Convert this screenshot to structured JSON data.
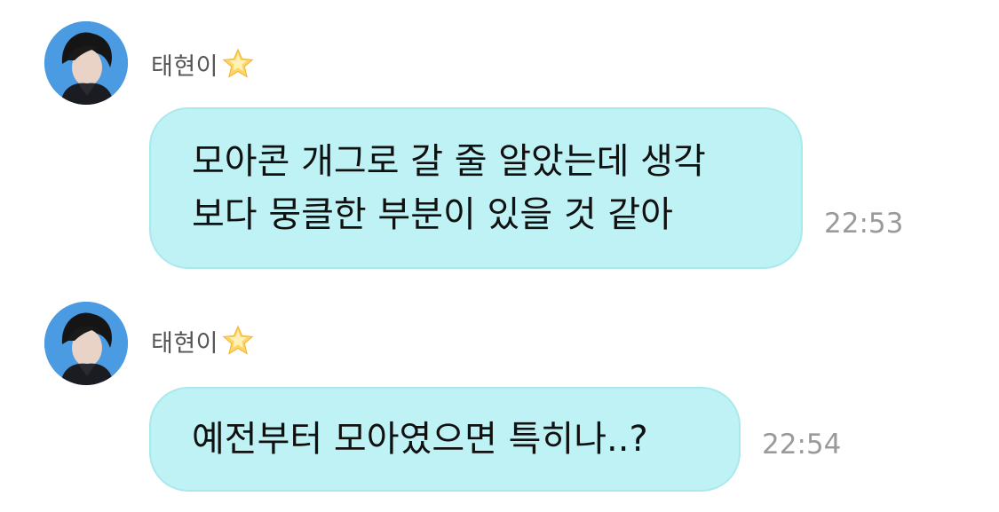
{
  "messages": [
    {
      "sender": "태현이",
      "sender_badge": "star-icon",
      "lines": [
        "모아콘 개그로 갈 줄 알았는데 생각",
        "보다 뭉클한 부분이 있을 것 같아"
      ],
      "time": "22:53"
    },
    {
      "sender": "태현이",
      "sender_badge": "star-icon",
      "lines": [
        "예전부터 모아였으면 특히나..?"
      ],
      "time": "22:54"
    }
  ],
  "colors": {
    "bubble": "#bff2f5",
    "bubble_border": "#a9e9ee",
    "timestamp": "#9a9a9a",
    "sender": "#555555"
  }
}
